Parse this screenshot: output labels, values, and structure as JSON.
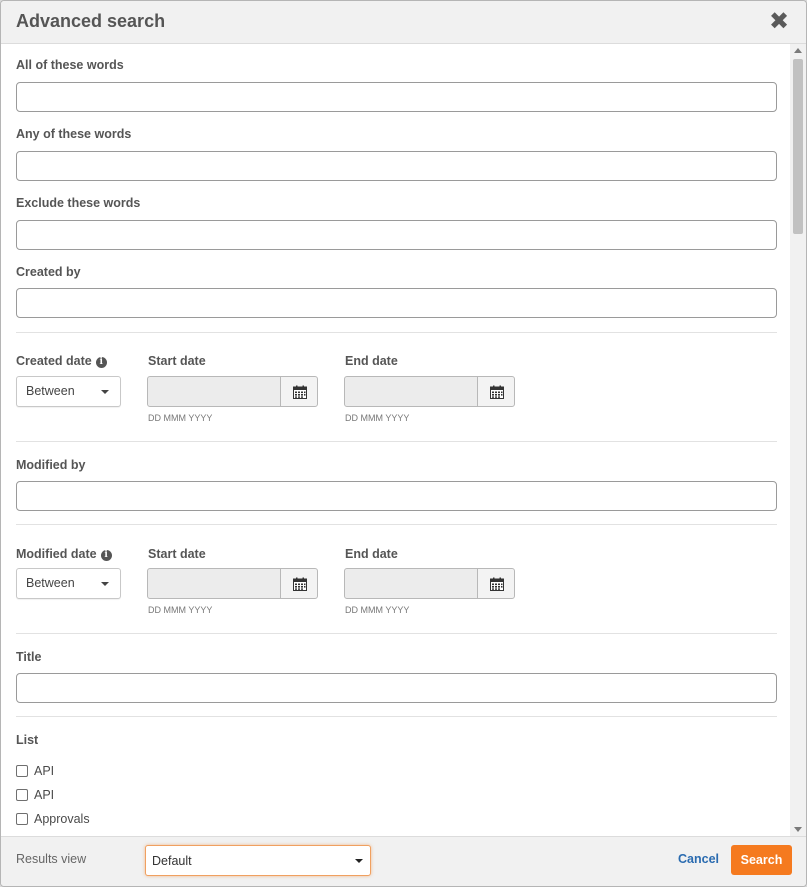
{
  "dialog": {
    "title": "Advanced search",
    "close_icon": "close-icon"
  },
  "fields": {
    "all_words_label": "All of these words",
    "any_words_label": "Any of these words",
    "exclude_words_label": "Exclude these words",
    "created_by_label": "Created by",
    "modified_by_label": "Modified by",
    "title_label": "Title"
  },
  "created_date": {
    "label": "Created date",
    "mode": "Between",
    "start_label": "Start date",
    "end_label": "End date",
    "start_hint": "DD MMM YYYY",
    "end_hint": "DD MMM YYYY"
  },
  "modified_date": {
    "label": "Modified date",
    "mode": "Between",
    "start_label": "Start date",
    "end_label": "End date",
    "start_hint": "DD MMM YYYY",
    "end_hint": "DD MMM YYYY"
  },
  "list": {
    "label": "List",
    "items": [
      "API",
      "API",
      "Approvals"
    ]
  },
  "footer": {
    "results_view_label": "Results view",
    "results_view_value": "Default",
    "cancel_label": "Cancel",
    "search_label": "Search"
  },
  "colors": {
    "accent": "#f57a1f",
    "link": "#2a6bb0"
  }
}
